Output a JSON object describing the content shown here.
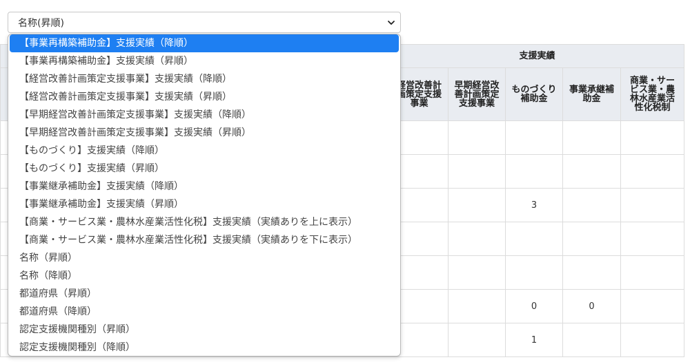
{
  "sort_select": {
    "value": "名称(昇順)",
    "icon": "chevron-down-icon"
  },
  "dropdown": {
    "selected_index": 0,
    "options": [
      "【事業再構築補助金】支援実績（降順）",
      "【事業再構築補助金】支援実績（昇順）",
      "【経営改善計画策定支援事業】支援実績（降順）",
      "【経営改善計画策定支援事業】支援実績（昇順）",
      "【早期経営改善計画策定支援事業】支援実績（降順）",
      "【早期経営改善計画策定支援事業】支援実績（昇順）",
      "【ものづくり】支援実績（降順）",
      "【ものづくり】支援実績（昇順）",
      "【事業継承補助金】支援実績（降順）",
      "【事業継承補助金】支援実績（昇順）",
      "【商業・サービス業・農林水産業活性化税】支援実績（実績ありを上に表示）",
      "【商業・サービス業・農林水産業活性化税】支援実績（実績ありを下に表示）",
      "名称（昇順）",
      "名称（降順）",
      "都道府県（昇順）",
      "都道府県（降順）",
      "認定支援機関種別（昇順）",
      "認定支援機関種別（降順）"
    ]
  },
  "table": {
    "group_header": "支援実績",
    "columns": [
      "経営改善計画策定支援事業",
      "早期経営改善計画策定支援事業",
      "ものづくり補助金",
      "事業承継補助金",
      "商業・サービス業・農林水産業活性化税制"
    ],
    "column_lines": [
      [
        "経営改善計",
        "画策定支援",
        "事業"
      ],
      [
        "早期経営改",
        "善計画策定",
        "支援事業"
      ],
      [
        "ものづくり",
        "補助金"
      ],
      [
        "事業承継補",
        "助金"
      ],
      [
        "商業・サー",
        "ビス業・農",
        "林水産業活",
        "性化税制"
      ]
    ],
    "rows": [
      [
        "",
        "",
        "",
        "",
        ""
      ],
      [
        "",
        "",
        "",
        "",
        ""
      ],
      [
        "",
        "",
        "3",
        "",
        ""
      ],
      [
        "",
        "",
        "",
        "",
        ""
      ],
      [
        "",
        "",
        "",
        "",
        ""
      ],
      [
        "",
        "",
        "0",
        "0",
        ""
      ],
      [
        "",
        "",
        "1",
        "",
        ""
      ]
    ]
  }
}
